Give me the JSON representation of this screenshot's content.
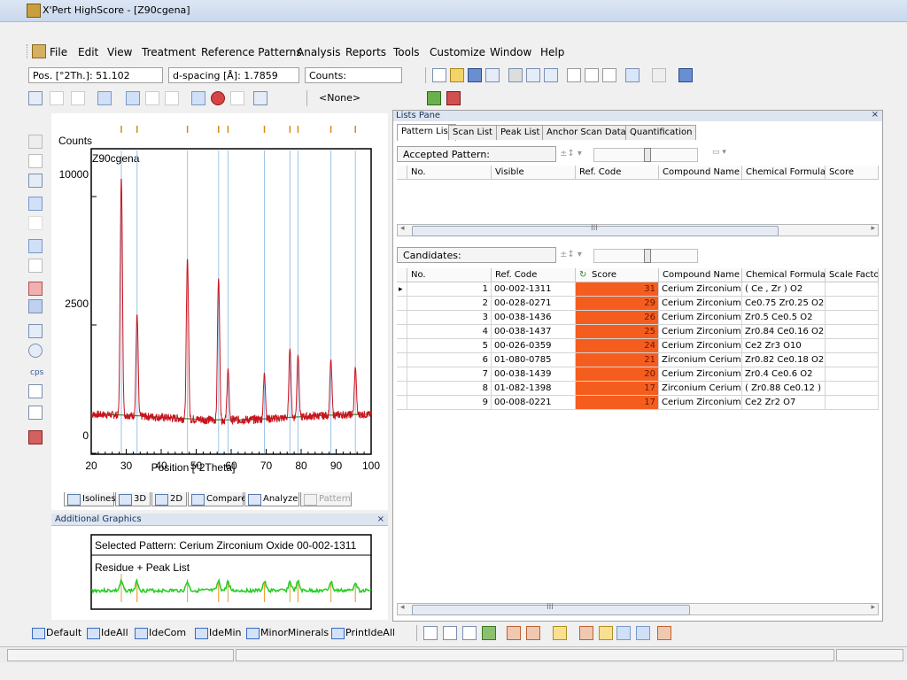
{
  "window": {
    "title": "X'Pert HighScore - [Z90cgena]"
  },
  "menu": [
    "File",
    "Edit",
    "View",
    "Treatment",
    "Reference Patterns",
    "Analysis",
    "Reports",
    "Tools",
    "Customize",
    "Window",
    "Help"
  ],
  "readouts": {
    "position": "Pos. [°2Th.]: 51.102",
    "dspacing": "d-spacing [Å]: 1.7859",
    "counts": "Counts:"
  },
  "toolbar2": {
    "none_select": "<None>"
  },
  "chart": {
    "ylabel": "Counts",
    "scan_name": "Z90cgena",
    "xlabel": "Position [°2Theta]",
    "yticks": [
      "10000",
      "2500",
      "0"
    ],
    "xticks": [
      "20",
      "30",
      "40",
      "50",
      "60",
      "70",
      "80",
      "90",
      "100"
    ]
  },
  "chart_data": {
    "type": "line",
    "title": "",
    "series_name": "Z90cgena",
    "xlabel": "Position [°2Theta]",
    "ylabel": "Counts",
    "xlim": [
      20,
      100
    ],
    "y_axis_scale": "sqrt",
    "yticks": [
      0,
      2500,
      10000
    ],
    "peaks": [
      {
        "x": 28.6,
        "y": 11300
      },
      {
        "x": 33.1,
        "y": 2700
      },
      {
        "x": 47.5,
        "y": 5600
      },
      {
        "x": 56.4,
        "y": 4500
      },
      {
        "x": 59.1,
        "y": 900
      },
      {
        "x": 69.5,
        "y": 800
      },
      {
        "x": 76.8,
        "y": 1500
      },
      {
        "x": 79.1,
        "y": 1300
      },
      {
        "x": 88.5,
        "y": 1100
      },
      {
        "x": 95.5,
        "y": 900
      }
    ],
    "background_level": 200,
    "reference_stick_positions": [
      28.6,
      33.1,
      47.5,
      56.4,
      59.1,
      69.5,
      76.8,
      79.1,
      88.5,
      95.5
    ],
    "colors": {
      "pattern": "#c8141e",
      "background": "#2e8b3a",
      "sticks": "#9cc3e6",
      "markers": "#d48a1a"
    }
  },
  "chart_tabs": [
    "Isolines",
    "3D",
    "2D",
    "Compare",
    "Analyze",
    "Pattern"
  ],
  "additional_graphics": {
    "title": "Additional Graphics",
    "selected_pattern": "Selected Pattern: Cerium Zirconium Oxide  00-002-1311",
    "residue_label": "Residue + Peak List"
  },
  "lists_pane": {
    "title": "Lists Pane",
    "tabs": [
      "Pattern List",
      "Scan List",
      "Peak List",
      "Anchor Scan Data",
      "Quantification"
    ],
    "accepted_label": "Accepted Pattern:",
    "accepted_columns": [
      "No.",
      "Visible",
      "Ref. Code",
      "Compound Name",
      "Chemical Formula",
      "Score"
    ],
    "candidates_label": "Candidates:",
    "candidate_columns": [
      "No.",
      "Ref. Code",
      "Score",
      "Compound Name",
      "Chemical Formula",
      "Scale Factor"
    ],
    "candidates": [
      {
        "no": "1",
        "ref": "00-002-1311",
        "score": "31",
        "name": "Cerium Zirconium ...",
        "formula": "( Ce , Zr ) O2"
      },
      {
        "no": "2",
        "ref": "00-028-0271",
        "score": "29",
        "name": "Cerium Zirconium ...",
        "formula": "Ce0.75 Zr0.25 O2"
      },
      {
        "no": "3",
        "ref": "00-038-1436",
        "score": "26",
        "name": "Cerium Zirconium ...",
        "formula": "Zr0.5 Ce0.5 O2"
      },
      {
        "no": "4",
        "ref": "00-038-1437",
        "score": "25",
        "name": "Cerium Zirconium ...",
        "formula": "Zr0.84 Ce0.16 O2"
      },
      {
        "no": "5",
        "ref": "00-026-0359",
        "score": "24",
        "name": "Cerium Zirconium ...",
        "formula": "Ce2 Zr3 O10"
      },
      {
        "no": "6",
        "ref": "01-080-0785",
        "score": "21",
        "name": "Zirconium Cerium ...",
        "formula": "Zr0.82 Ce0.18 O2"
      },
      {
        "no": "7",
        "ref": "00-038-1439",
        "score": "20",
        "name": "Cerium Zirconium ...",
        "formula": "Zr0.4 Ce0.6 O2"
      },
      {
        "no": "8",
        "ref": "01-082-1398",
        "score": "17",
        "name": "Zirconium Cerium ...",
        "formula": "( Zr0.88 Ce0.12 ) ..."
      },
      {
        "no": "9",
        "ref": "00-008-0221",
        "score": "17",
        "name": "Cerium Zirconium ...",
        "formula": "Ce2 Zr2 O7"
      }
    ],
    "scroll_label": "III"
  },
  "bottom_toolbar": [
    "Default",
    "IdeAll",
    "IdeCom",
    "IdeMin",
    "MinorMinerals",
    "PrintIdeAll"
  ]
}
